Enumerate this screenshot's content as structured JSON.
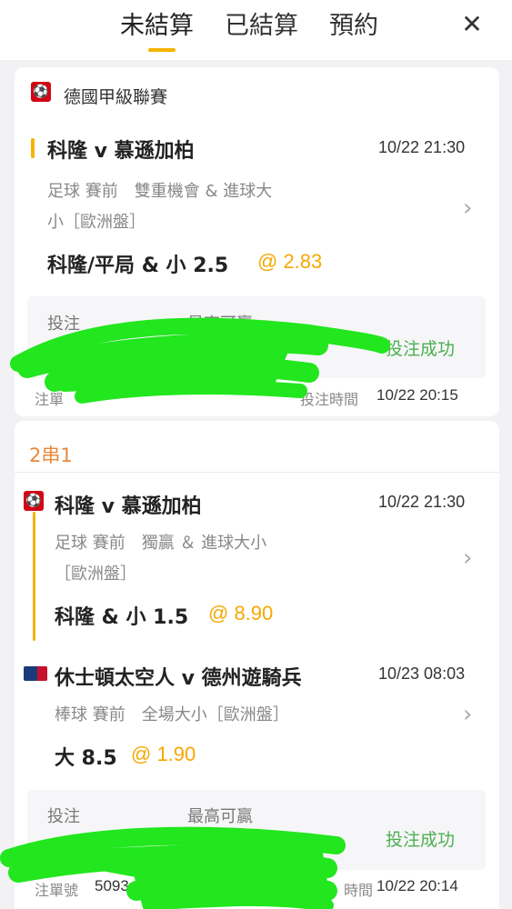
{
  "header": {
    "tabs": [
      {
        "label": "未結算",
        "active": true
      },
      {
        "label": "已結算",
        "active": false
      },
      {
        "label": "預約",
        "active": false
      }
    ],
    "close_icon": "close-icon",
    "accent_color": "#f5b400"
  },
  "bet1": {
    "league": "德國甲級聯賽",
    "league_icon": "bundesliga-icon",
    "match": "科隆 v 慕遜加柏",
    "time": "10/22 21:30",
    "desc_line1": "足球 賽前　雙重機會 & 進球大",
    "desc_line2": "小［歐洲盤］",
    "selection": "科隆/平局 & 小 2.5",
    "odds": "@ 2.83",
    "stake_label": "投注",
    "max_win_label": "最高可贏",
    "status": "投注成功",
    "slip_label": "注單",
    "bet_time_label": "投注時間",
    "bet_time": "10/22 20:15"
  },
  "bet2": {
    "combo": "2串1",
    "legs": [
      {
        "league_icon": "bundesliga-icon",
        "match": "科隆 v 慕遜加柏",
        "time": "10/22 21:30",
        "desc_line1": "足球 賽前　獨贏 ＆ 進球大小",
        "desc_line2": "［歐洲盤］",
        "selection": "科隆 & 小 1.5",
        "odds": "@ 8.90"
      },
      {
        "league_icon": "mlb-icon",
        "match": "休士頓太空人 v 德州遊騎兵",
        "time": "10/23 08:03",
        "desc_line1": "棒球 賽前　全場大小［歐洲盤］",
        "selection": "大 8.5",
        "odds": "@ 1.90"
      }
    ],
    "stake_label": "投注",
    "max_win_label": "最高可贏",
    "status": "投注成功",
    "slip_label": "注單號",
    "slip_no_partial": "5093",
    "bet_time_label": "時間",
    "bet_time": "10/22 20:14"
  },
  "colors": {
    "odds": "#f5a800",
    "success": "#4caf50",
    "combo": "#e8873a",
    "redaction": "#22e61e"
  }
}
